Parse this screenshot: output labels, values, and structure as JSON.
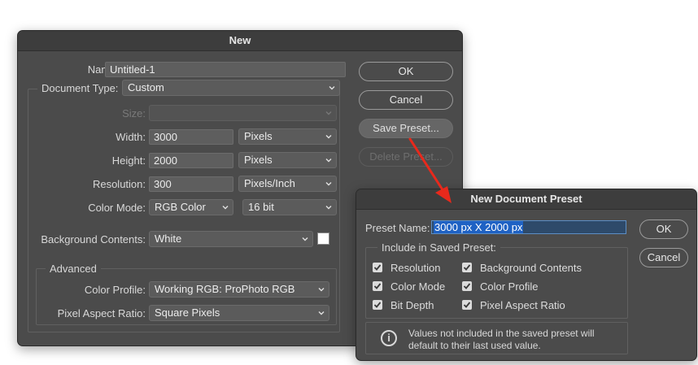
{
  "new_dialog": {
    "title": "New",
    "name_label": "Name:",
    "name_value": "Untitled-1",
    "document_type_label": "Document Type:",
    "document_type_value": "Custom",
    "size_label": "Size:",
    "size_value": "",
    "width_label": "Width:",
    "width_value": "3000",
    "width_unit": "Pixels",
    "height_label": "Height:",
    "height_value": "2000",
    "height_unit": "Pixels",
    "resolution_label": "Resolution:",
    "resolution_value": "300",
    "resolution_unit": "Pixels/Inch",
    "color_mode_label": "Color Mode:",
    "color_mode_value": "RGB Color",
    "bit_depth_value": "16 bit",
    "background_label": "Background Contents:",
    "background_value": "White",
    "background_swatch": "#ffffff",
    "advanced_label": "Advanced",
    "color_profile_label": "Color Profile:",
    "color_profile_value": "Working RGB:  ProPhoto RGB",
    "pixel_aspect_label": "Pixel Aspect Ratio:",
    "pixel_aspect_value": "Square Pixels",
    "ok_label": "OK",
    "cancel_label": "Cancel",
    "save_preset_label": "Save Preset...",
    "delete_preset_label": "Delete Preset..."
  },
  "preset_dialog": {
    "title": "New Document Preset",
    "preset_name_label": "Preset Name:",
    "preset_name_value": "3000 px X 2000 px",
    "include_label": "Include in Saved Preset:",
    "checkboxes": [
      {
        "label": "Resolution",
        "checked": true
      },
      {
        "label": "Color Mode",
        "checked": true
      },
      {
        "label": "Bit Depth",
        "checked": true
      },
      {
        "label": "Background Contents",
        "checked": true
      },
      {
        "label": "Color Profile",
        "checked": true
      },
      {
        "label": "Pixel Aspect Ratio",
        "checked": true
      }
    ],
    "info_line1": "Values not included in the saved preset will",
    "info_line2": "default to their last used value.",
    "ok_label": "OK",
    "cancel_label": "Cancel"
  },
  "annotation_arrow_color": "#e8291c"
}
